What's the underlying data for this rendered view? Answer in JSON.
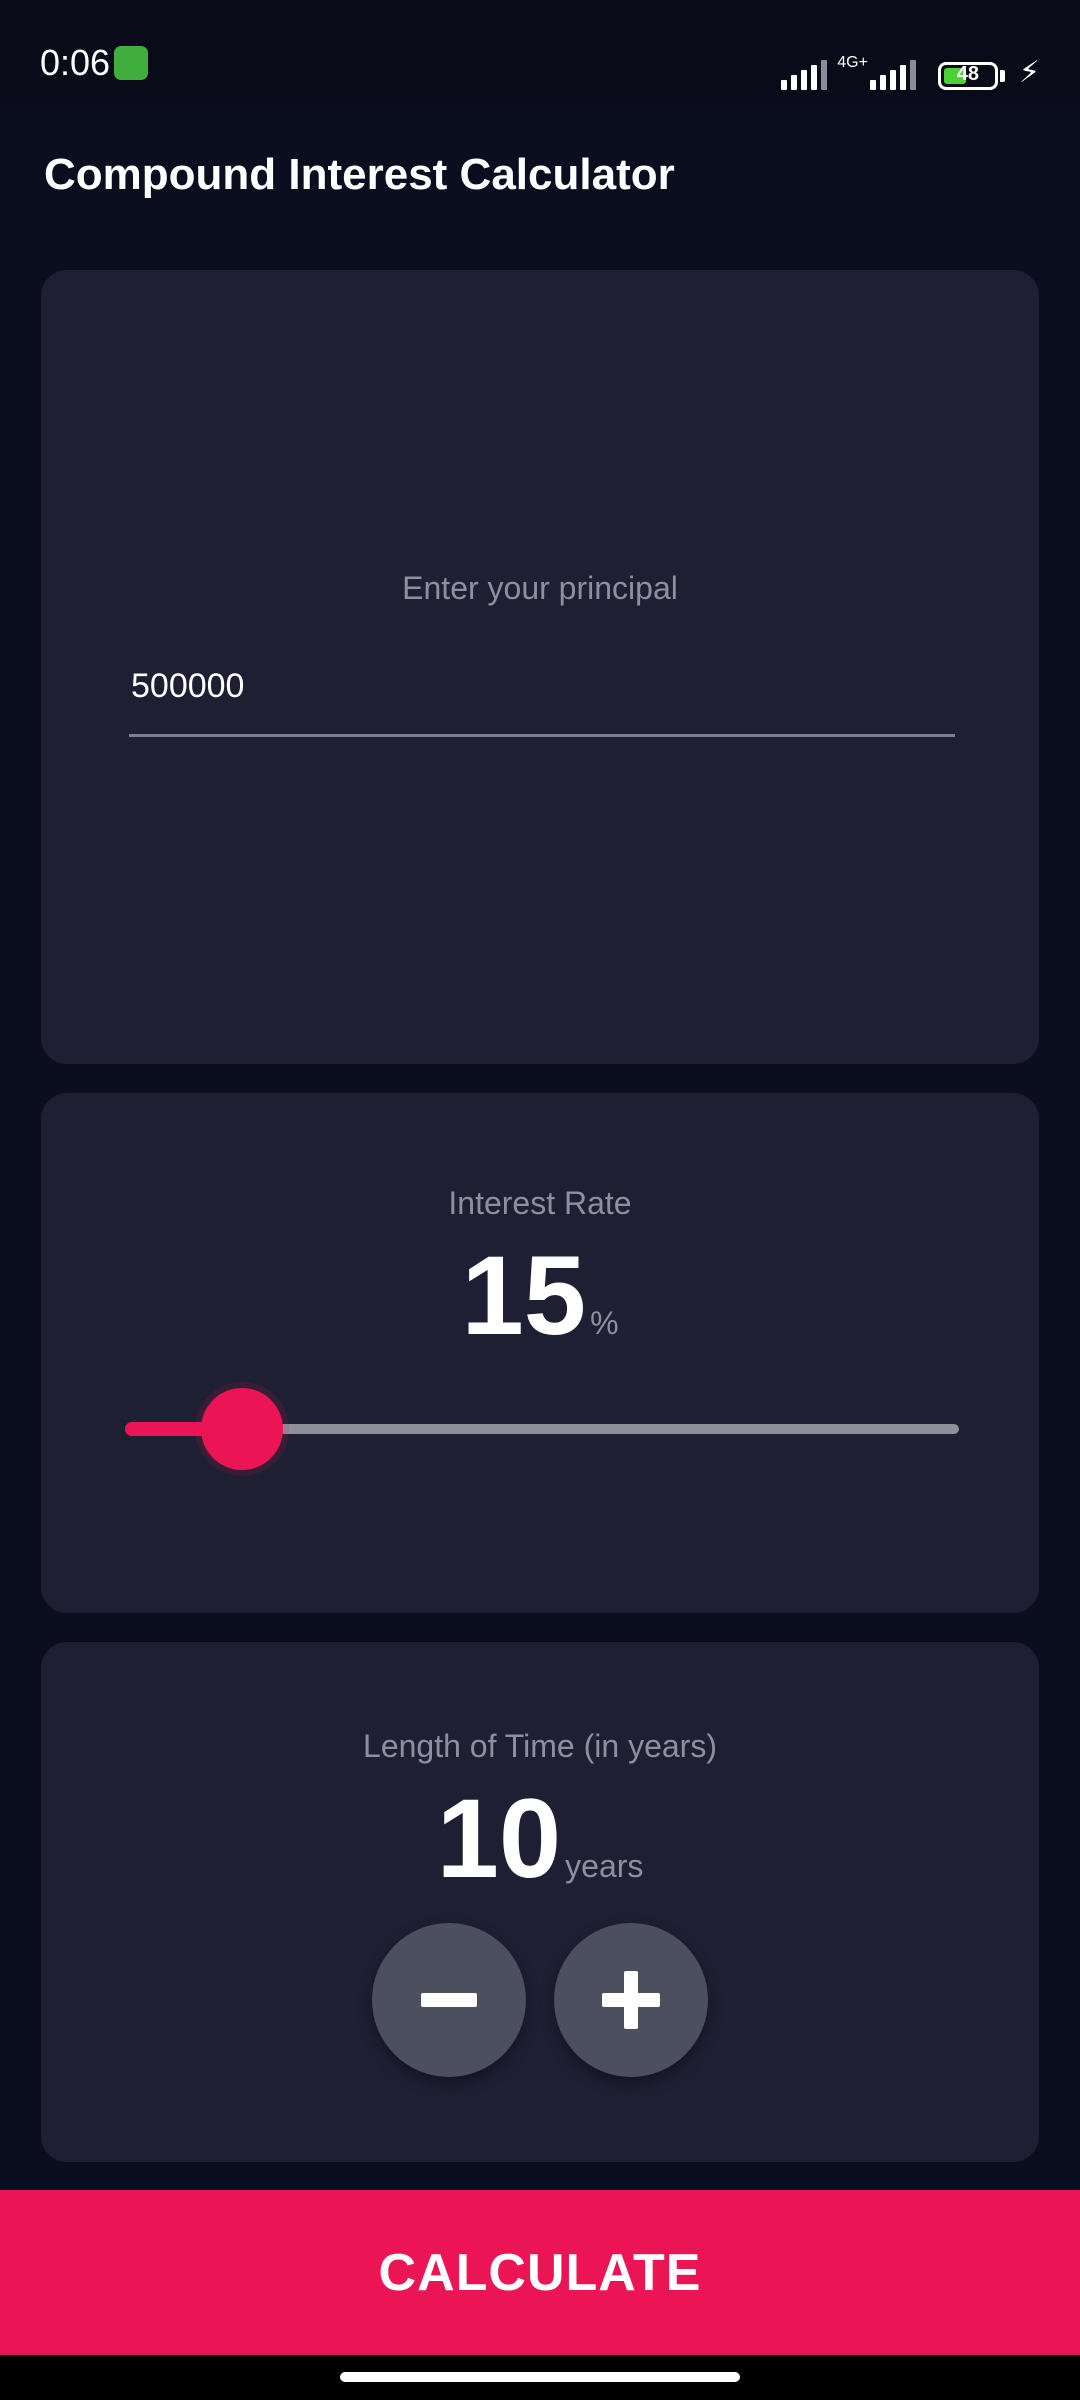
{
  "status_bar": {
    "time": "0:06",
    "network": "4G+",
    "battery": "48",
    "app_icon": "android-robot-icon",
    "charging_icon": "lightning-icon"
  },
  "app_bar": {
    "title": "Compound Interest Calculator"
  },
  "principal": {
    "label": "Enter your principal",
    "value": "500000"
  },
  "interest_rate": {
    "label": "Interest Rate",
    "value": "15",
    "unit": "%",
    "slider_fraction": 0.14
  },
  "time": {
    "label": "Length of Time (in years)",
    "value": "10",
    "unit": "years",
    "decrement_icon": "minus-icon",
    "increment_icon": "plus-icon"
  },
  "actions": {
    "calculate_label": "CALCULATE"
  },
  "colors": {
    "background": "#0b0e1f",
    "card": "#1e1f33",
    "accent": "#eb1555",
    "muted_text": "#8e8f9f",
    "round_button": "#4c4f5e"
  }
}
